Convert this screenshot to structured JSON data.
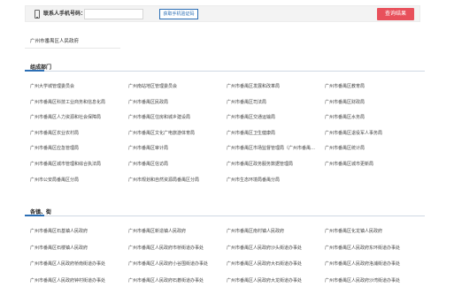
{
  "search": {
    "phone_label": "联系人手机号码：",
    "phone_value": "",
    "code_button": "获取手机验证码",
    "query_button": "查询结果"
  },
  "gov_link": "广州市番禺区人民政府",
  "sections": [
    {
      "title": "组成部门",
      "items": [
        "广州大学城管理委员会",
        "广州南站地区管理委员会",
        "广州市番禺区发展和改革局",
        "广州市番禺区教育局",
        "广州市番禺区科技工业商务和信息化局",
        "广州市番禺区民政局",
        "广州市番禺区司法局",
        "广州市番禺区财政局",
        "广州市番禺区人力资源和社会保障局",
        "广州市番禺区住房和城乡建设局",
        "广州市番禺区交通运输局",
        "广州市番禺区水务局",
        "广州市番禺区农业农村局",
        "广州市番禺区文化广电旅游体育局",
        "广州市番禺区卫生健康局",
        "广州市番禺区退役军人事务局",
        "广州市番禺区应急管理局",
        "广州市番禺区审计局",
        "广州市番禺区市场监督管理局（广州市番禺…",
        "广州市番禺区统计局",
        "广州市番禺区城市管理和综合执法局",
        "广州市番禺区信访局",
        "广州市番禺区政务服务数据管理局",
        "广州市番禺区城市更新局",
        "广州市公安局番禺区分局",
        "广州市规划和自然资源局番禺区分局",
        "广州市生态环境局番禺分局"
      ]
    },
    {
      "title": "各镇、街",
      "items": [
        "广州市番禺区石基镇人民政府",
        "广州市番禺区新造镇人民政府",
        "广州市番禺区南村镇人民政府",
        "广州市番禺区化龙镇人民政府",
        "广州市番禺区石楼镇人民政府",
        "广州市番禺区人民政府市桥街道办事处",
        "广州市番禺区人民政府沙头街道办事处",
        "广州市番禺区人民政府东环街道办事处",
        "广州市番禺区人民政府桥南街道办事处",
        "广州市番禺区人民政府小谷围街道办事处",
        "广州市番禺区人民政府大石街道办事处",
        "广州市番禺区人民政府洛浦街道办事处",
        "广州市番禺区人民政府钟村街道办事处",
        "广州市番禺区人民政府石碁街道办事处",
        "广州市番禺区人民政府大龙街道办事处",
        "广州市番禺区人民政府沙湾街道办事处"
      ]
    }
  ]
}
